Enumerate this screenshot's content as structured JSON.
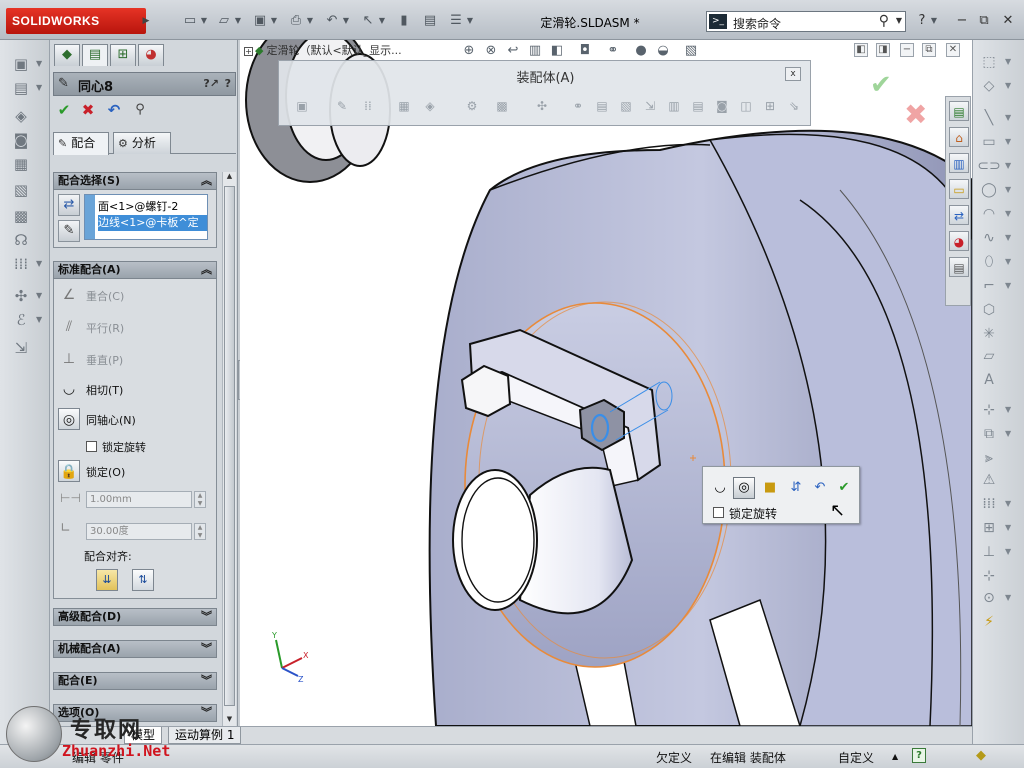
{
  "app": {
    "logo_text": "SOLIDWORKS",
    "document_title": "定滑轮.SLDASM *",
    "command_search_placeholder": "搜索命令",
    "window_controls": [
      "minimize",
      "restore",
      "close"
    ]
  },
  "quick_access": [
    "new-icon",
    "open-icon",
    "save-icon",
    "print-icon",
    "undo-icon",
    "select-icon",
    "rebuild-icon",
    "file-properties-icon",
    "options-icon"
  ],
  "property_manager": {
    "tabs": [
      "feature-manager-icon",
      "property-manager-icon",
      "configuration-manager-icon",
      "appearance-icon"
    ],
    "title": "同心8",
    "help_label": "?",
    "subtabs": [
      {
        "label": "配合",
        "icon": "mate-icon"
      },
      {
        "label": "分析",
        "icon": "analysis-icon"
      }
    ],
    "mate_selection": {
      "title": "配合选择(S)",
      "items": [
        "面<1>@螺钉-2",
        "边线<1>@卡板^定"
      ]
    },
    "standard_mates": {
      "title": "标准配合(A)",
      "items": [
        {
          "label": "重合(C)",
          "enabled": false,
          "icon": "coincident-icon"
        },
        {
          "label": "平行(R)",
          "enabled": false,
          "icon": "parallel-icon"
        },
        {
          "label": "垂直(P)",
          "enabled": false,
          "icon": "perpendicular-icon"
        },
        {
          "label": "相切(T)",
          "enabled": true,
          "icon": "tangent-icon"
        },
        {
          "label": "同轴心(N)",
          "enabled": true,
          "icon": "concentric-icon"
        }
      ],
      "lock_rotation_label": "锁定旋转",
      "lock_label": "锁定(O)",
      "distance_value": "1.00mm",
      "angle_value": "30.00度",
      "alignment_label": "配合对齐:"
    },
    "collapsed_sections": [
      "高级配合(D)",
      "机械配合(A)",
      "配合(E)",
      "选项(O)"
    ]
  },
  "graphics": {
    "tree_flyout": "定滑轮（默认<默认_显示...",
    "assembly_toolbar_title": "装配体(A)",
    "close_label": "x",
    "context_toolbar": {
      "buttons": [
        "tangent-icon",
        "concentric-icon",
        "lock-icon",
        "flip-alignment-icon",
        "undo-icon",
        "ok-icon"
      ],
      "selected": "concentric-icon",
      "lock_rotation_label": "锁定旋转"
    },
    "triad_labels": [
      "Y",
      "X",
      "Z"
    ]
  },
  "bottom_tabs": [
    "模型",
    "运动算例 1"
  ],
  "status_bar": {
    "left": "编辑 零件",
    "under_defined": "欠定义",
    "editing": "在编辑 装配体",
    "custom": "自定义"
  },
  "watermark": {
    "chinese": "专取网",
    "url": "Zhuanzhi.Net"
  },
  "colors": {
    "ok_green": "#2a9a2a",
    "cancel_red": "#c8202a",
    "selection_orange": "#e88a3a",
    "part_lavender": "#b9bfda",
    "watermark_red": "#d0141e"
  }
}
